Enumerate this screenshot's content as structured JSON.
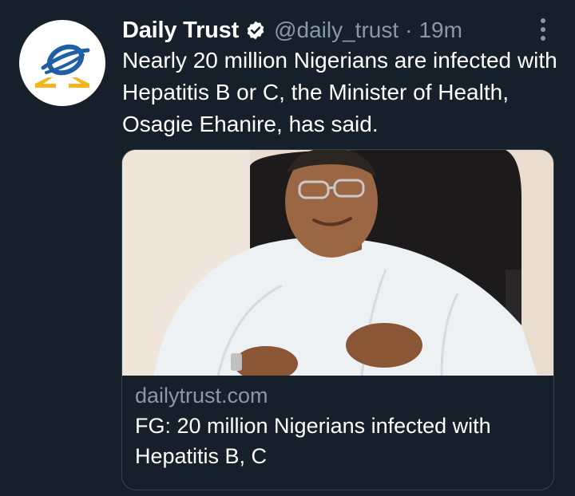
{
  "tweet": {
    "author_name": "Daily Trust",
    "handle": "@daily_trust",
    "separator": "·",
    "time": "19m",
    "text": "Nearly 20 million Nigerians are infected with Hepatitis B or C, the Minister of Health, Osagie Ehanire, has said.",
    "verified": true
  },
  "card": {
    "domain": "dailytrust.com",
    "title": "FG: 20 million Nigerians infected with Hepatitis B, C"
  },
  "colors": {
    "background": "#15202b",
    "secondary_text": "#8b98a5",
    "border": "#38444d",
    "verified_badge": "#ffffff",
    "logo_blue": "#1f5fa6",
    "logo_gold": "#f2b51c"
  },
  "icons": {
    "avatar": "daily-trust-logo",
    "verified": "verified-badge-icon",
    "more": "more-options-icon"
  }
}
